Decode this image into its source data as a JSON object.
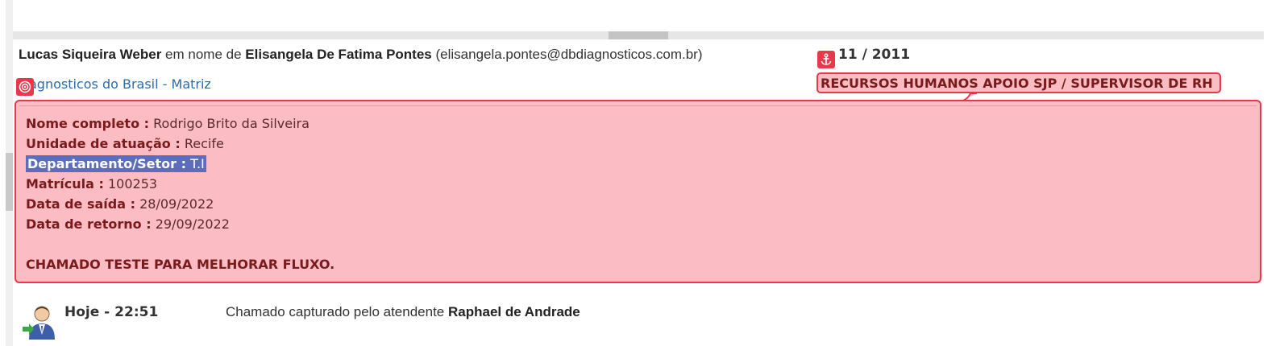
{
  "ticket": {
    "requester_name": "Lucas Siqueira Weber",
    "on_behalf_text": "em nome de",
    "beneficiary_name": "Elisangela De Fatima Pontes",
    "beneficiary_email": "(elisangela.pontes@dbdiagnosticos.com.br)",
    "date_fragment": "11 / 2011",
    "company": "agnosticos do Brasil - Matriz",
    "department": "RECURSOS HUMANOS APOIO SJP / SUPERVISOR DE RH"
  },
  "description": {
    "fields": [
      {
        "label": "Nome completo :",
        "value": "Rodrigo Brito da Silveira"
      },
      {
        "label": "Unidade de atuação :",
        "value": "Recife"
      },
      {
        "label": "Departamento/Setor :",
        "value": "T.I"
      },
      {
        "label": "Matrícula :",
        "value": "100253"
      },
      {
        "label": "Data de saída :",
        "value": "28/09/2022"
      },
      {
        "label": "Data de retorno :",
        "value": "29/09/2022"
      }
    ],
    "note": "CHAMADO TESTE PARA MELHORAR FLUXO."
  },
  "event": {
    "time": "Hoje - 22:51",
    "text": "Chamado capturado pelo atendente",
    "agent": "Raphael de Andrade",
    "icon": "user-agent-icon"
  },
  "colors": {
    "highlight_fill": "#fbbcc3",
    "highlight_border": "#e8384a",
    "selection": "#5d6dbd",
    "link": "#2b6ca8"
  }
}
